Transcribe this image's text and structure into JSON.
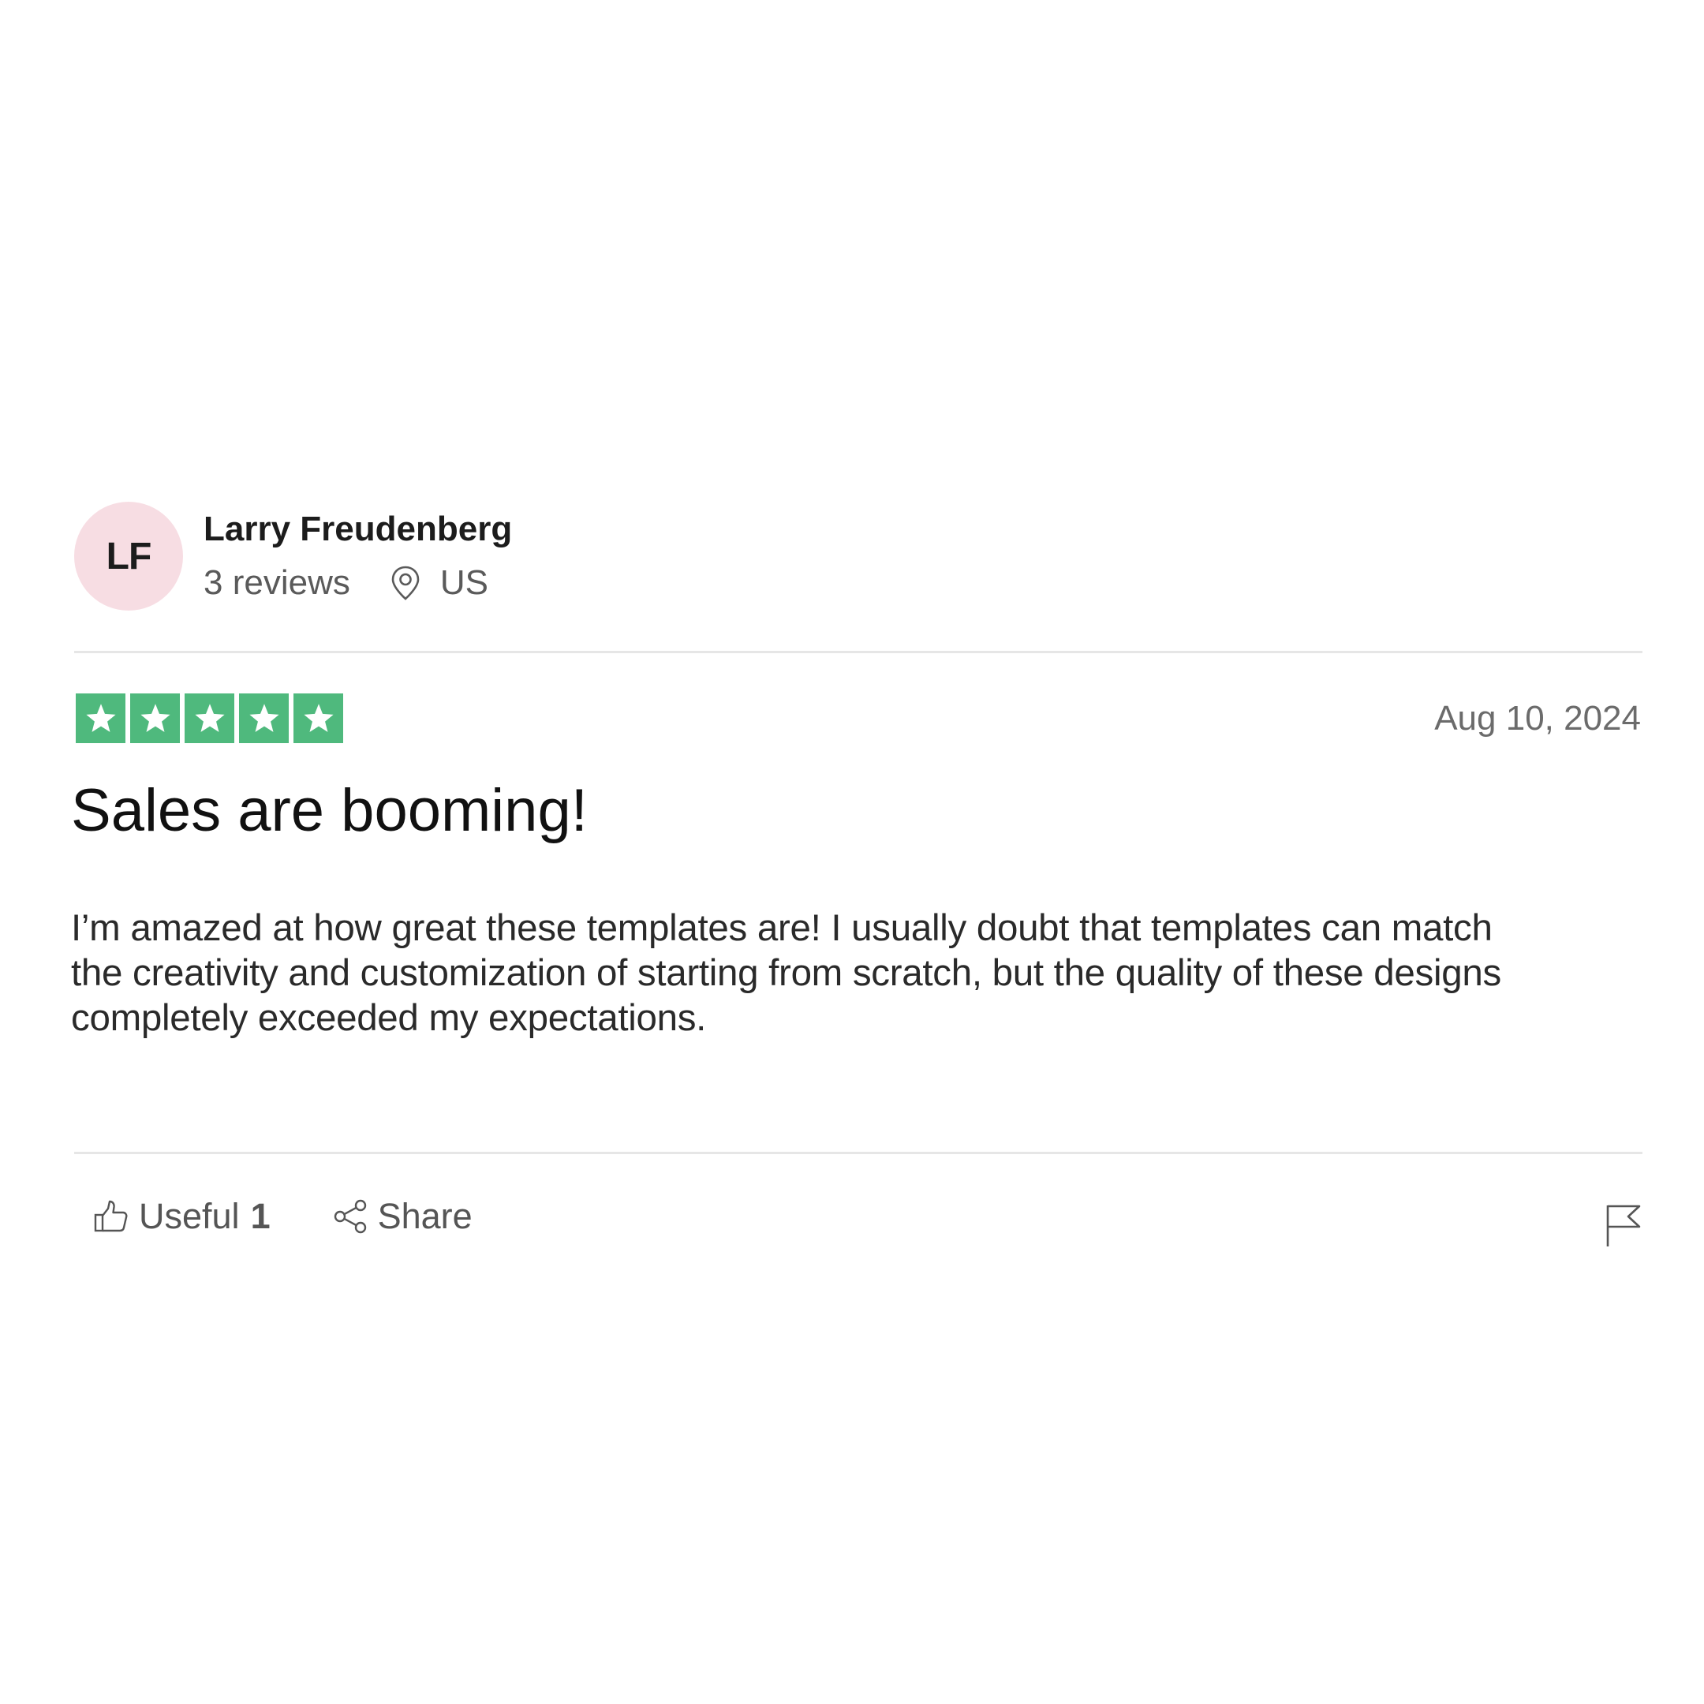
{
  "reviewer": {
    "initials": "LF",
    "name": "Larry Freudenberg",
    "review_count": "3 reviews",
    "location": "US",
    "avatar_color": "#f7dde3"
  },
  "review": {
    "rating": 5,
    "rating_max": 5,
    "star_color": "#4fb97d",
    "date": "Aug 10, 2024",
    "title": "Sales are booming!",
    "body": "I’m amazed at how great these templates are! I usually doubt that templates can match the creativity and customization of starting from scratch, but the quality of these designs completely exceeded my expectations."
  },
  "actions": {
    "useful_label": "Useful",
    "useful_count": "1",
    "share_label": "Share",
    "useful_icon": "thumbs-up-icon",
    "share_icon": "share-icon",
    "report_icon": "flag-icon"
  }
}
